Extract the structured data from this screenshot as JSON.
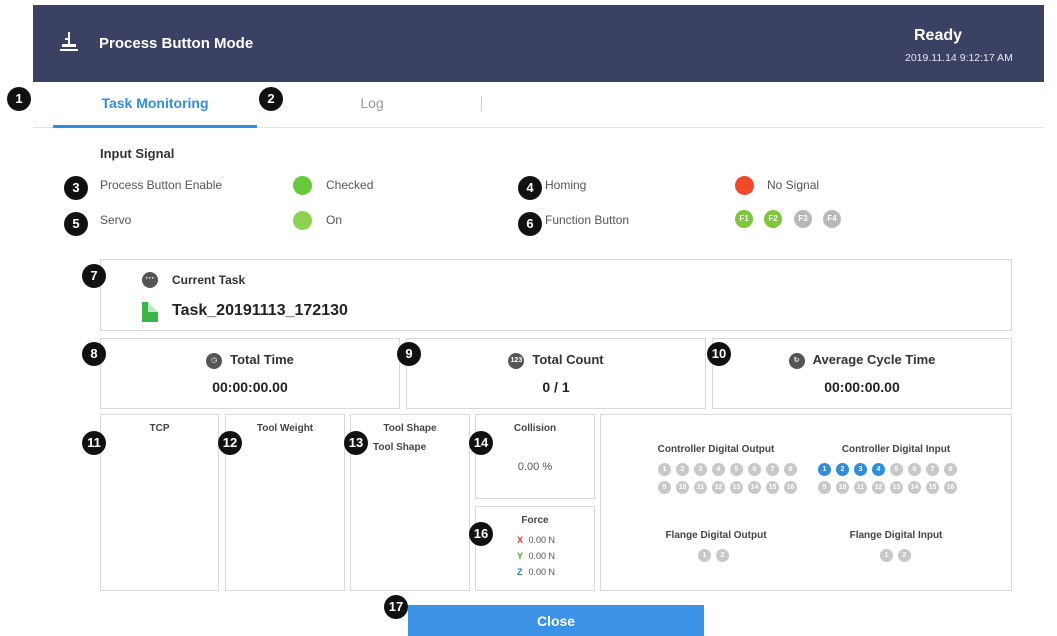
{
  "header": {
    "title": "Process Button Mode",
    "status": "Ready",
    "datetime": "2019.11.14 9:12:17 AM"
  },
  "tabs": [
    {
      "label": "Task Monitoring",
      "active": true
    },
    {
      "label": "Log",
      "active": false
    }
  ],
  "callouts": [
    "1",
    "2",
    "3",
    "4",
    "5",
    "6",
    "7",
    "8",
    "9",
    "10",
    "11",
    "12",
    "13",
    "14",
    "16",
    "17"
  ],
  "input_signal": {
    "title": "Input Signal",
    "process_button_enable": {
      "label": "Process Button Enable",
      "value": "Checked",
      "color": "#6ac93a"
    },
    "homing": {
      "label": "Homing",
      "value": "No Signal",
      "color": "#f1492a"
    },
    "servo": {
      "label": "Servo",
      "value": "On",
      "color": "#8ad24f"
    },
    "function_button": {
      "label": "Function Button",
      "buttons": [
        {
          "label": "F1",
          "on": true
        },
        {
          "label": "F2",
          "on": true
        },
        {
          "label": "F3",
          "on": false
        },
        {
          "label": "F4",
          "on": false
        }
      ]
    }
  },
  "current_task": {
    "label": "Current Task",
    "name": "Task_20191113_172130"
  },
  "stats": {
    "total_time": {
      "label": "Total Time",
      "value": "00:00:00.00"
    },
    "total_count": {
      "label": "Total Count",
      "value": "0 / 1",
      "icon_text": "123"
    },
    "average_cycle_time": {
      "label": "Average Cycle Time",
      "value": "00:00:00.00"
    }
  },
  "panels": {
    "tcp": "TCP",
    "tool_weight": "Tool Weight",
    "tool_shape": "Tool Shape",
    "tool_shape_sub": "Tool Shape",
    "collision": {
      "label": "Collision",
      "value": "0.00 %"
    },
    "force": {
      "label": "Force",
      "x": {
        "axis": "X",
        "value": "0.00 N",
        "color": "#e03a3a"
      },
      "y": {
        "axis": "Y",
        "value": "0.00 N",
        "color": "#4aa832"
      },
      "z": {
        "axis": "Z",
        "value": "0.00 N",
        "color": "#2f6fd8"
      }
    }
  },
  "io": {
    "controller_digital_output": {
      "label": "Controller Digital Output",
      "on": []
    },
    "controller_digital_input": {
      "label": "Controller Digital Input",
      "on": [
        1,
        2,
        3,
        4
      ]
    },
    "flange_digital_output": {
      "label": "Flange Digital Output",
      "on": []
    },
    "flange_digital_input": {
      "label": "Flange Digital Input",
      "on": []
    },
    "numbers_16": [
      "1",
      "2",
      "3",
      "4",
      "5",
      "6",
      "7",
      "8",
      "9",
      "10",
      "11",
      "12",
      "13",
      "14",
      "15",
      "16"
    ],
    "numbers_2": [
      "1",
      "2"
    ]
  },
  "close_label": "Close",
  "colors": {
    "accent": "#2f8de0",
    "header": "#3a4163",
    "off": "#c8c8c8"
  }
}
